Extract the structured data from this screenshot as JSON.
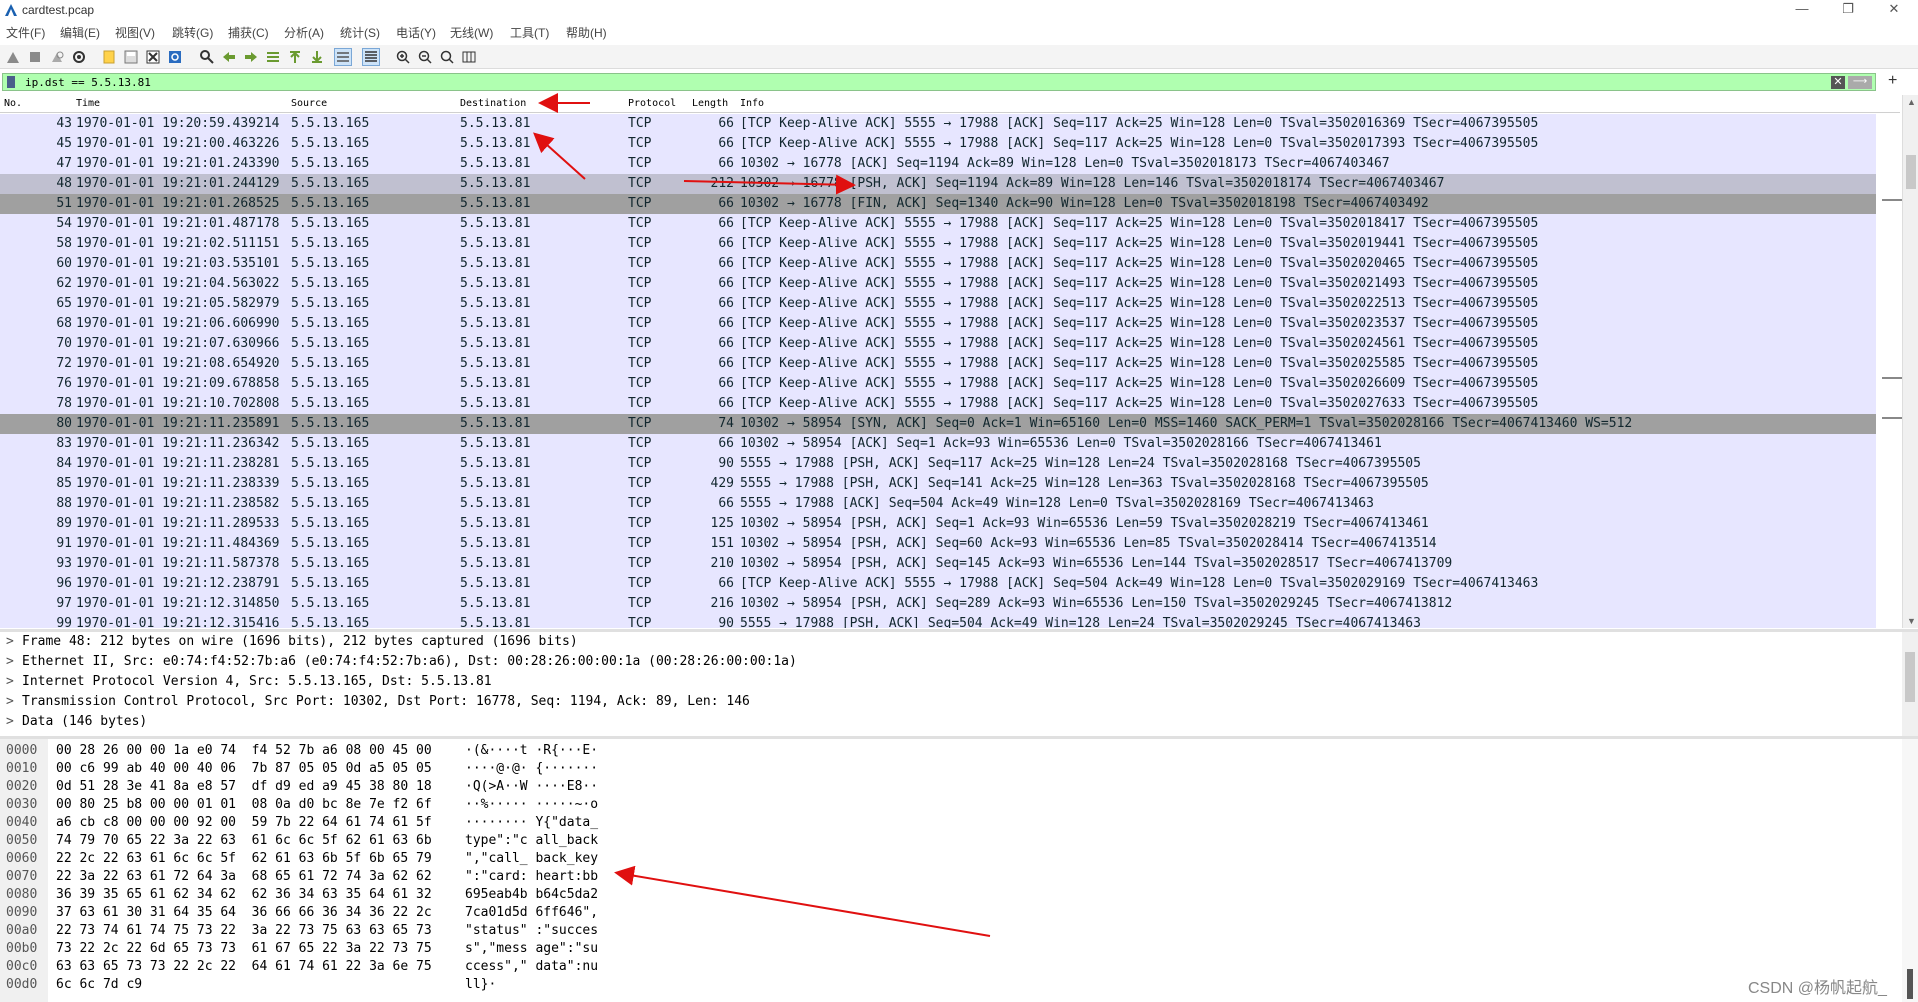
{
  "window": {
    "title": "cardtest.pcap",
    "controls": {
      "minimize": "—",
      "maximize": "❐",
      "close": "✕"
    }
  },
  "menu": [
    "文件(F)",
    "编辑(E)",
    "视图(V)",
    "跳转(G)",
    "捕获(C)",
    "分析(A)",
    "统计(S)",
    "电话(Y)",
    "无线(W)",
    "工具(T)",
    "帮助(H)"
  ],
  "toolbar_icons": [
    "shark-fin-icon",
    "stop-icon",
    "restart-icon",
    "options-icon",
    "open-file-icon",
    "save-icon",
    "close-file-icon",
    "reload-icon",
    "find-icon",
    "back-icon",
    "forward-icon",
    "goto-icon",
    "first-icon",
    "last-icon",
    "autoscroll-icon",
    "colorize-icon",
    "zoom-in-icon",
    "zoom-out-icon",
    "zoom-reset-icon",
    "resize-columns-icon"
  ],
  "filter": {
    "value": "ip.dst == 5.5.13.81",
    "clear_glyph": "✕",
    "apply_glyph": "⟶",
    "add_glyph": "+"
  },
  "columns": {
    "no": "No.",
    "time": "Time",
    "source": "Source",
    "destination": "Destination",
    "protocol": "Protocol",
    "length": "Length",
    "info": "Info"
  },
  "packets": [
    {
      "no": "43",
      "time": "1970-01-01 19:20:59.439214",
      "src": "5.5.13.165",
      "dst": "5.5.13.81",
      "proto": "TCP",
      "len": "66",
      "info": "[TCP Keep-Alive ACK] 5555 → 17988 [ACK] Seq=117 Ack=25 Win=128 Len=0 TSval=3502016369 TSecr=4067395505",
      "style": ""
    },
    {
      "no": "45",
      "time": "1970-01-01 19:21:00.463226",
      "src": "5.5.13.165",
      "dst": "5.5.13.81",
      "proto": "TCP",
      "len": "66",
      "info": "[TCP Keep-Alive ACK] 5555 → 17988 [ACK] Seq=117 Ack=25 Win=128 Len=0 TSval=3502017393 TSecr=4067395505",
      "style": ""
    },
    {
      "no": "47",
      "time": "1970-01-01 19:21:01.243390",
      "src": "5.5.13.165",
      "dst": "5.5.13.81",
      "proto": "TCP",
      "len": "66",
      "info": "10302 → 16778 [ACK] Seq=1194 Ack=89 Win=128 Len=0 TSval=3502018173 TSecr=4067403467",
      "style": ""
    },
    {
      "no": "48",
      "time": "1970-01-01 19:21:01.244129",
      "src": "5.5.13.165",
      "dst": "5.5.13.81",
      "proto": "TCP",
      "len": "212",
      "info": "10302 → 16778 [PSH, ACK] Seq=1194 Ack=89 Win=128 Len=146 TSval=3502018174 TSecr=4067403467",
      "style": "sel"
    },
    {
      "no": "51",
      "time": "1970-01-01 19:21:01.268525",
      "src": "5.5.13.165",
      "dst": "5.5.13.81",
      "proto": "TCP",
      "len": "66",
      "info": "10302 → 16778 [FIN, ACK] Seq=1340 Ack=90 Win=128 Len=0 TSval=3502018198 TSecr=4067403492",
      "style": "dark"
    },
    {
      "no": "54",
      "time": "1970-01-01 19:21:01.487178",
      "src": "5.5.13.165",
      "dst": "5.5.13.81",
      "proto": "TCP",
      "len": "66",
      "info": "[TCP Keep-Alive ACK] 5555 → 17988 [ACK] Seq=117 Ack=25 Win=128 Len=0 TSval=3502018417 TSecr=4067395505",
      "style": ""
    },
    {
      "no": "58",
      "time": "1970-01-01 19:21:02.511151",
      "src": "5.5.13.165",
      "dst": "5.5.13.81",
      "proto": "TCP",
      "len": "66",
      "info": "[TCP Keep-Alive ACK] 5555 → 17988 [ACK] Seq=117 Ack=25 Win=128 Len=0 TSval=3502019441 TSecr=4067395505",
      "style": ""
    },
    {
      "no": "60",
      "time": "1970-01-01 19:21:03.535101",
      "src": "5.5.13.165",
      "dst": "5.5.13.81",
      "proto": "TCP",
      "len": "66",
      "info": "[TCP Keep-Alive ACK] 5555 → 17988 [ACK] Seq=117 Ack=25 Win=128 Len=0 TSval=3502020465 TSecr=4067395505",
      "style": ""
    },
    {
      "no": "62",
      "time": "1970-01-01 19:21:04.563022",
      "src": "5.5.13.165",
      "dst": "5.5.13.81",
      "proto": "TCP",
      "len": "66",
      "info": "[TCP Keep-Alive ACK] 5555 → 17988 [ACK] Seq=117 Ack=25 Win=128 Len=0 TSval=3502021493 TSecr=4067395505",
      "style": ""
    },
    {
      "no": "65",
      "time": "1970-01-01 19:21:05.582979",
      "src": "5.5.13.165",
      "dst": "5.5.13.81",
      "proto": "TCP",
      "len": "66",
      "info": "[TCP Keep-Alive ACK] 5555 → 17988 [ACK] Seq=117 Ack=25 Win=128 Len=0 TSval=3502022513 TSecr=4067395505",
      "style": ""
    },
    {
      "no": "68",
      "time": "1970-01-01 19:21:06.606990",
      "src": "5.5.13.165",
      "dst": "5.5.13.81",
      "proto": "TCP",
      "len": "66",
      "info": "[TCP Keep-Alive ACK] 5555 → 17988 [ACK] Seq=117 Ack=25 Win=128 Len=0 TSval=3502023537 TSecr=4067395505",
      "style": ""
    },
    {
      "no": "70",
      "time": "1970-01-01 19:21:07.630966",
      "src": "5.5.13.165",
      "dst": "5.5.13.81",
      "proto": "TCP",
      "len": "66",
      "info": "[TCP Keep-Alive ACK] 5555 → 17988 [ACK] Seq=117 Ack=25 Win=128 Len=0 TSval=3502024561 TSecr=4067395505",
      "style": ""
    },
    {
      "no": "72",
      "time": "1970-01-01 19:21:08.654920",
      "src": "5.5.13.165",
      "dst": "5.5.13.81",
      "proto": "TCP",
      "len": "66",
      "info": "[TCP Keep-Alive ACK] 5555 → 17988 [ACK] Seq=117 Ack=25 Win=128 Len=0 TSval=3502025585 TSecr=4067395505",
      "style": ""
    },
    {
      "no": "76",
      "time": "1970-01-01 19:21:09.678858",
      "src": "5.5.13.165",
      "dst": "5.5.13.81",
      "proto": "TCP",
      "len": "66",
      "info": "[TCP Keep-Alive ACK] 5555 → 17988 [ACK] Seq=117 Ack=25 Win=128 Len=0 TSval=3502026609 TSecr=4067395505",
      "style": ""
    },
    {
      "no": "78",
      "time": "1970-01-01 19:21:10.702808",
      "src": "5.5.13.165",
      "dst": "5.5.13.81",
      "proto": "TCP",
      "len": "66",
      "info": "[TCP Keep-Alive ACK] 5555 → 17988 [ACK] Seq=117 Ack=25 Win=128 Len=0 TSval=3502027633 TSecr=4067395505",
      "style": ""
    },
    {
      "no": "80",
      "time": "1970-01-01 19:21:11.235891",
      "src": "5.5.13.165",
      "dst": "5.5.13.81",
      "proto": "TCP",
      "len": "74",
      "info": "10302 → 58954 [SYN, ACK] Seq=0 Ack=1 Win=65160 Len=0 MSS=1460 SACK_PERM=1 TSval=3502028166 TSecr=4067413460 WS=512",
      "style": "dark"
    },
    {
      "no": "83",
      "time": "1970-01-01 19:21:11.236342",
      "src": "5.5.13.165",
      "dst": "5.5.13.81",
      "proto": "TCP",
      "len": "66",
      "info": "10302 → 58954 [ACK] Seq=1 Ack=93 Win=65536 Len=0 TSval=3502028166 TSecr=4067413461",
      "style": ""
    },
    {
      "no": "84",
      "time": "1970-01-01 19:21:11.238281",
      "src": "5.5.13.165",
      "dst": "5.5.13.81",
      "proto": "TCP",
      "len": "90",
      "info": "5555 → 17988 [PSH, ACK] Seq=117 Ack=25 Win=128 Len=24 TSval=3502028168 TSecr=4067395505",
      "style": ""
    },
    {
      "no": "85",
      "time": "1970-01-01 19:21:11.238339",
      "src": "5.5.13.165",
      "dst": "5.5.13.81",
      "proto": "TCP",
      "len": "429",
      "info": "5555 → 17988 [PSH, ACK] Seq=141 Ack=25 Win=128 Len=363 TSval=3502028168 TSecr=4067395505",
      "style": ""
    },
    {
      "no": "88",
      "time": "1970-01-01 19:21:11.238582",
      "src": "5.5.13.165",
      "dst": "5.5.13.81",
      "proto": "TCP",
      "len": "66",
      "info": "5555 → 17988 [ACK] Seq=504 Ack=49 Win=128 Len=0 TSval=3502028169 TSecr=4067413463",
      "style": ""
    },
    {
      "no": "89",
      "time": "1970-01-01 19:21:11.289533",
      "src": "5.5.13.165",
      "dst": "5.5.13.81",
      "proto": "TCP",
      "len": "125",
      "info": "10302 → 58954 [PSH, ACK] Seq=1 Ack=93 Win=65536 Len=59 TSval=3502028219 TSecr=4067413461",
      "style": ""
    },
    {
      "no": "91",
      "time": "1970-01-01 19:21:11.484369",
      "src": "5.5.13.165",
      "dst": "5.5.13.81",
      "proto": "TCP",
      "len": "151",
      "info": "10302 → 58954 [PSH, ACK] Seq=60 Ack=93 Win=65536 Len=85 TSval=3502028414 TSecr=4067413514",
      "style": ""
    },
    {
      "no": "93",
      "time": "1970-01-01 19:21:11.587378",
      "src": "5.5.13.165",
      "dst": "5.5.13.81",
      "proto": "TCP",
      "len": "210",
      "info": "10302 → 58954 [PSH, ACK] Seq=145 Ack=93 Win=65536 Len=144 TSval=3502028517 TSecr=4067413709",
      "style": ""
    },
    {
      "no": "96",
      "time": "1970-01-01 19:21:12.238791",
      "src": "5.5.13.165",
      "dst": "5.5.13.81",
      "proto": "TCP",
      "len": "66",
      "info": "[TCP Keep-Alive ACK] 5555 → 17988 [ACK] Seq=504 Ack=49 Win=128 Len=0 TSval=3502029169 TSecr=4067413463",
      "style": ""
    },
    {
      "no": "97",
      "time": "1970-01-01 19:21:12.314850",
      "src": "5.5.13.165",
      "dst": "5.5.13.81",
      "proto": "TCP",
      "len": "216",
      "info": "10302 → 58954 [PSH, ACK] Seq=289 Ack=93 Win=65536 Len=150 TSval=3502029245 TSecr=4067413812",
      "style": ""
    },
    {
      "no": "99",
      "time": "1970-01-01 19:21:12.315416",
      "src": "5.5.13.165",
      "dst": "5.5.13.81",
      "proto": "TCP",
      "len": "90",
      "info": "5555 → 17988 [PSH, ACK] Seq=504 Ack=49 Win=128 Len=24 TSval=3502029245 TSecr=4067413463",
      "style": ""
    }
  ],
  "details": [
    "Frame 48: 212 bytes on wire (1696 bits), 212 bytes captured (1696 bits)",
    "Ethernet II, Src: e0:74:f4:52:7b:a6 (e0:74:f4:52:7b:a6), Dst: 00:28:26:00:00:1a (00:28:26:00:00:1a)",
    "Internet Protocol Version 4, Src: 5.5.13.165, Dst: 5.5.13.81",
    "Transmission Control Protocol, Src Port: 10302, Dst Port: 16778, Seq: 1194, Ack: 89, Len: 146",
    "Data (146 bytes)"
  ],
  "bytes": [
    {
      "off": "0000",
      "hex": "00 28 26 00 00 1a e0 74  f4 52 7b a6 08 00 45 00",
      "ascii": "·(&····t ·R{···E·"
    },
    {
      "off": "0010",
      "hex": "00 c6 99 ab 40 00 40 06  7b 87 05 05 0d a5 05 05",
      "ascii": "····@·@· {·······"
    },
    {
      "off": "0020",
      "hex": "0d 51 28 3e 41 8a e8 57  df d9 ed a9 45 38 80 18",
      "ascii": "·Q(>A··W ····E8··"
    },
    {
      "off": "0030",
      "hex": "00 80 25 b8 00 00 01 01  08 0a d0 bc 8e 7e f2 6f",
      "ascii": "··%····· ·····~·o"
    },
    {
      "off": "0040",
      "hex": "a6 cb c8 00 00 00 92 00  59 7b 22 64 61 74 61 5f",
      "ascii": "········ Y{\"data_"
    },
    {
      "off": "0050",
      "hex": "74 79 70 65 22 3a 22 63  61 6c 6c 5f 62 61 63 6b",
      "ascii": "type\":\"c all_back"
    },
    {
      "off": "0060",
      "hex": "22 2c 22 63 61 6c 6c 5f  62 61 63 6b 5f 6b 65 79",
      "ascii": "\",\"call_ back_key"
    },
    {
      "off": "0070",
      "hex": "22 3a 22 63 61 72 64 3a  68 65 61 72 74 3a 62 62",
      "ascii": "\":\"card: heart:bb"
    },
    {
      "off": "0080",
      "hex": "36 39 35 65 61 62 34 62  62 36 34 63 35 64 61 32",
      "ascii": "695eab4b b64c5da2"
    },
    {
      "off": "0090",
      "hex": "37 63 61 30 31 64 35 64  36 66 66 36 34 36 22 2c",
      "ascii": "7ca01d5d 6ff646\","
    },
    {
      "off": "00a0",
      "hex": "22 73 74 61 74 75 73 22  3a 22 73 75 63 63 65 73",
      "ascii": "\"status\" :\"succes"
    },
    {
      "off": "00b0",
      "hex": "73 22 2c 22 6d 65 73 73  61 67 65 22 3a 22 73 75",
      "ascii": "s\",\"mess age\":\"su"
    },
    {
      "off": "00c0",
      "hex": "63 63 65 73 73 22 2c 22  64 61 74 61 22 3a 6e 75",
      "ascii": "ccess\",\" data\":nu"
    },
    {
      "off": "00d0",
      "hex": "6c 6c 7d c9",
      "ascii": "ll}·"
    }
  ],
  "watermark": "CSDN @杨帆起航_",
  "colors": {
    "filter_bg": "#b0ffb0",
    "row_bg": "#e7e6ff",
    "row_selected": "#c0c0d0",
    "row_dark": "#a0a0a0",
    "annotation_arrow": "#e01010"
  }
}
